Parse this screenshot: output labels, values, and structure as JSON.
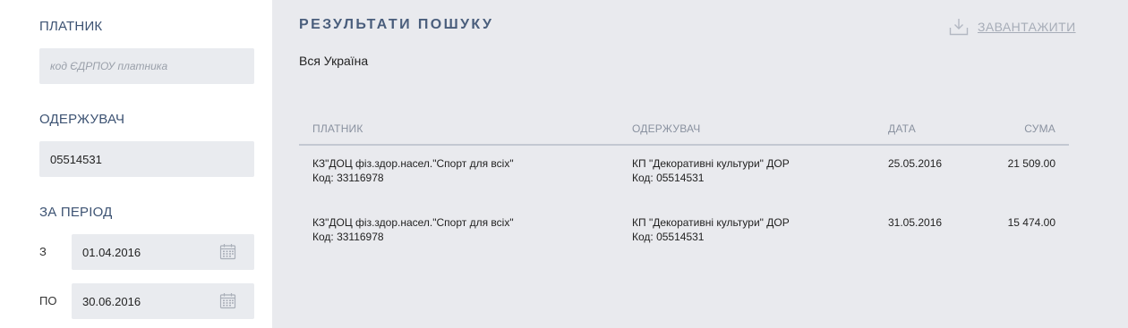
{
  "sidebar": {
    "payer_label": "ПЛАТНИК",
    "payer_placeholder": "код ЄДРПОУ платника",
    "payer_value": "",
    "recipient_label": "ОДЕРЖУВАЧ",
    "recipient_value": "05514531",
    "period_label": "ЗА ПЕРІОД",
    "from_label": "З",
    "from_value": "01.04.2016",
    "to_label": "ПО",
    "to_value": "30.06.2016"
  },
  "main": {
    "title": "РЕЗУЛЬТАТИ ПОШУКУ",
    "download_label": "ЗАВАНТАЖИТИ",
    "region": "Вся Україна",
    "columns": [
      "ПЛАТНИК",
      "ОДЕРЖУВАЧ",
      "ДАТА",
      "СУМА"
    ],
    "rows": [
      {
        "payer_name": "КЗ\"ДОЦ фіз.здор.насел.\"Спорт для всіх\"",
        "payer_code": "Код: 33116978",
        "recipient_name": "КП \"Декоративні культури\" ДОР",
        "recipient_code": "Код: 05514531",
        "date": "25.05.2016",
        "amount": "21 509.00"
      },
      {
        "payer_name": "КЗ\"ДОЦ фіз.здор.насел.\"Спорт для всіх\"",
        "payer_code": "Код: 33116978",
        "recipient_name": "КП \"Декоративні культури\" ДОР",
        "recipient_code": "Код: 05514531",
        "date": "31.05.2016",
        "amount": "15 474.00"
      }
    ]
  },
  "icons": {
    "download": "download-icon",
    "calendar": "calendar-icon"
  },
  "colors": {
    "panel_bg": "#e9eaee",
    "field_bg": "#e9ebef",
    "heading": "#4a5e7c",
    "muted": "#a7adb8"
  }
}
